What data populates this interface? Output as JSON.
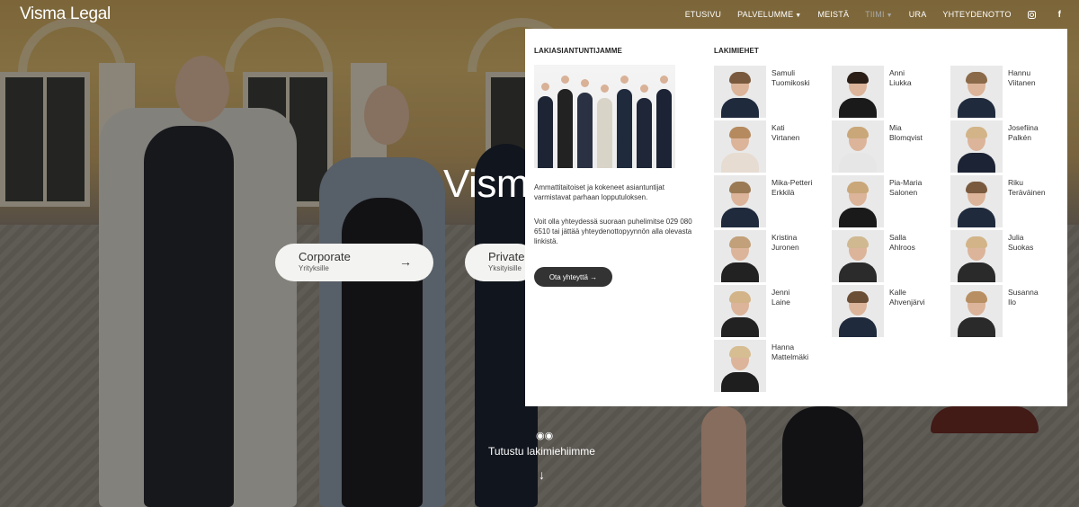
{
  "brand": {
    "logo": "Visma Legal"
  },
  "nav": {
    "items": [
      {
        "label": "ETUSIVU",
        "dropdown": false,
        "active": false
      },
      {
        "label": "PALVELUMME",
        "dropdown": true,
        "active": false
      },
      {
        "label": "MEISTÄ",
        "dropdown": false,
        "active": false
      },
      {
        "label": "TIIMI",
        "dropdown": true,
        "active": true
      },
      {
        "label": "URA",
        "dropdown": false,
        "active": false
      },
      {
        "label": "YHTEYDENOTTO",
        "dropdown": false,
        "active": false
      }
    ],
    "social": [
      "instagram-icon",
      "facebook-icon"
    ]
  },
  "hero": {
    "title": "Visma",
    "buttons": [
      {
        "label": "Corporate",
        "sub": "Yrityksille"
      },
      {
        "label": "Private",
        "sub": "Yksityisille"
      }
    ],
    "team_link": "Tutustu lakimiehiimme"
  },
  "dropdown": {
    "left": {
      "heading": "LAKIASIANTUNTIJAMME",
      "text1": "Ammattitaitoiset ja kokeneet asiantuntijat varmistavat parhaan lopputuloksen.",
      "text2": "Voit olla yhteydessä suoraan puhelimitse 029 080 6510 tai jättää yhteydenottopyynnön alla olevasta linkistä.",
      "button": "Ota yhteyttä →"
    },
    "right": {
      "heading": "LAKIMIEHET",
      "lawyers": [
        {
          "first": "Samuli",
          "last": "Tuomikoski"
        },
        {
          "first": "Anni",
          "last": "Liukka"
        },
        {
          "first": "Hannu",
          "last": "Viitanen"
        },
        {
          "first": "Kati",
          "last": "Virtanen"
        },
        {
          "first": "Mia",
          "last": "Blomqvist"
        },
        {
          "first": "Josefiina",
          "last": "Palkén"
        },
        {
          "first": "Mika-Petteri",
          "last": "Erkkilä"
        },
        {
          "first": "Pia-Maria",
          "last": "Salonen"
        },
        {
          "first": "Riku",
          "last": "Teräväinen"
        },
        {
          "first": "Kristina",
          "last": "Juronen"
        },
        {
          "first": "Salla",
          "last": "Ahlroos"
        },
        {
          "first": "Julia",
          "last": "Suokas"
        },
        {
          "first": "Jenni",
          "last": "Laine"
        },
        {
          "first": "Kalle",
          "last": "Ahvenjärvi"
        },
        {
          "first": "Susanna",
          "last": "Ilo"
        },
        {
          "first": "Hanna",
          "last": "Mattelmäki"
        }
      ]
    }
  },
  "colors": {
    "dropdown_bg": "#ffffff",
    "button_dark": "#333333",
    "nav_text": "#ffffff",
    "nav_active": "#a9a9a9"
  }
}
